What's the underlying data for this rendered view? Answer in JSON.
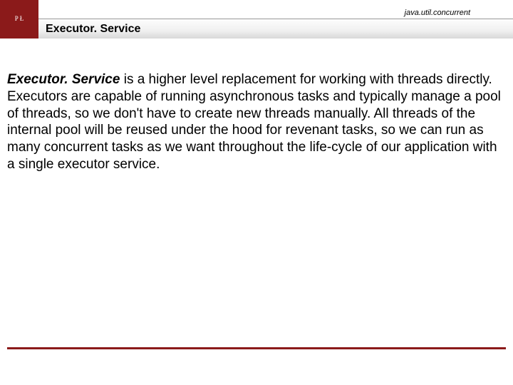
{
  "header": {
    "package": "java.util.concurrent",
    "title": "Executor. Service",
    "logo_text": "P Ł"
  },
  "content": {
    "lead": "Executor. Service",
    "body": " is a higher level replacement for working with threads directly. Executors are capable of running asynchronous tasks and typically manage a pool of threads, so we don't have to create new threads manually. All threads of the internal pool will be reused under the hood for revenant tasks, so we can run as many concurrent tasks as we want throughout the life-cycle of our application with a single executor service."
  }
}
